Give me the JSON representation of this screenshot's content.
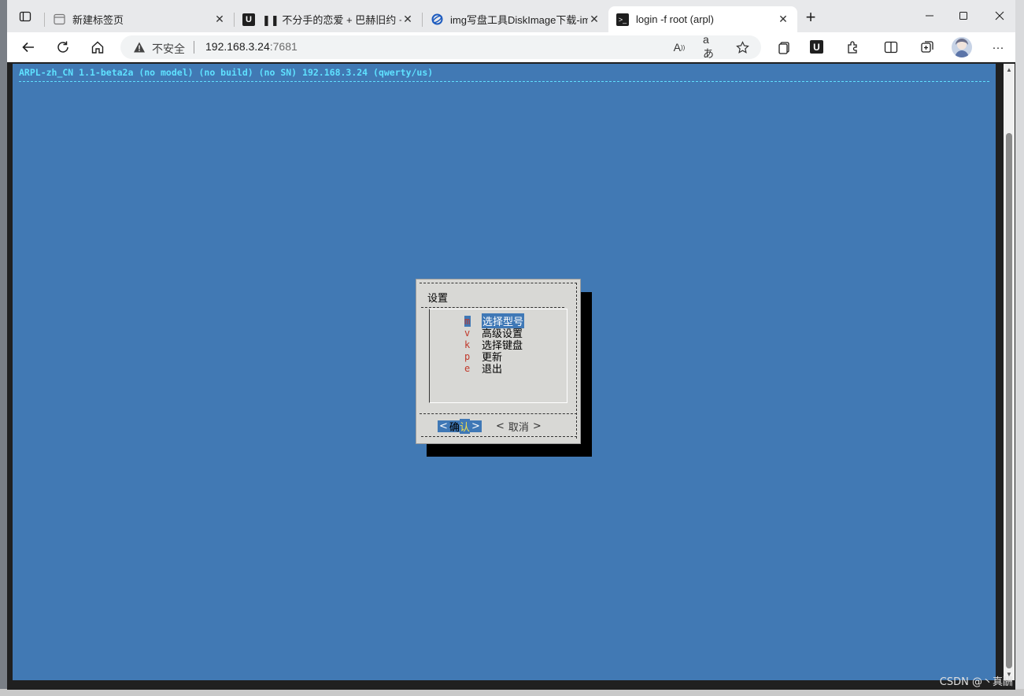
{
  "browser": {
    "tabs": [
      {
        "title": "新建标签页",
        "favicon": "new-tab-page-icon"
      },
      {
        "title": "❚❚ 不分手的恋爱 + 巴赫旧约 + 坏",
        "favicon": "app-u-icon"
      },
      {
        "title": "img写盘工具DiskImage下载-img",
        "favicon": "globe-icon"
      },
      {
        "title": "login -f root (arpl)",
        "favicon": "terminal-icon"
      }
    ],
    "insecure_label": "不安全",
    "url_host": "192.168.3.24",
    "url_port": ":7681"
  },
  "terminal": {
    "header": "ARPL-zh_CN 1.1-beta2a (no model) (no build) (no SN) 192.168.3.24 (qwerty/us)"
  },
  "dialog": {
    "title": "设置",
    "items": [
      {
        "key": "m",
        "label": "选择型号",
        "selected": true
      },
      {
        "key": "v",
        "label": "高级设置"
      },
      {
        "key": "k",
        "label": "选择键盘"
      },
      {
        "key": "p",
        "label": "更新"
      },
      {
        "key": "e",
        "label": "退出"
      }
    ],
    "ok_left": "<",
    "ok_label_a": "确",
    "ok_label_b": "认",
    "ok_right": ">",
    "cancel_left": "<",
    "cancel_label": "取消",
    "cancel_right": ">"
  },
  "watermark": "CSDN @丶真酬",
  "colors": {
    "terminal_bg": "#4179b4",
    "header_text": "#5fe1ff",
    "dialog_bg": "#d8d8d5",
    "hotkey": "#c0392b",
    "selection": "#3f78b6"
  }
}
